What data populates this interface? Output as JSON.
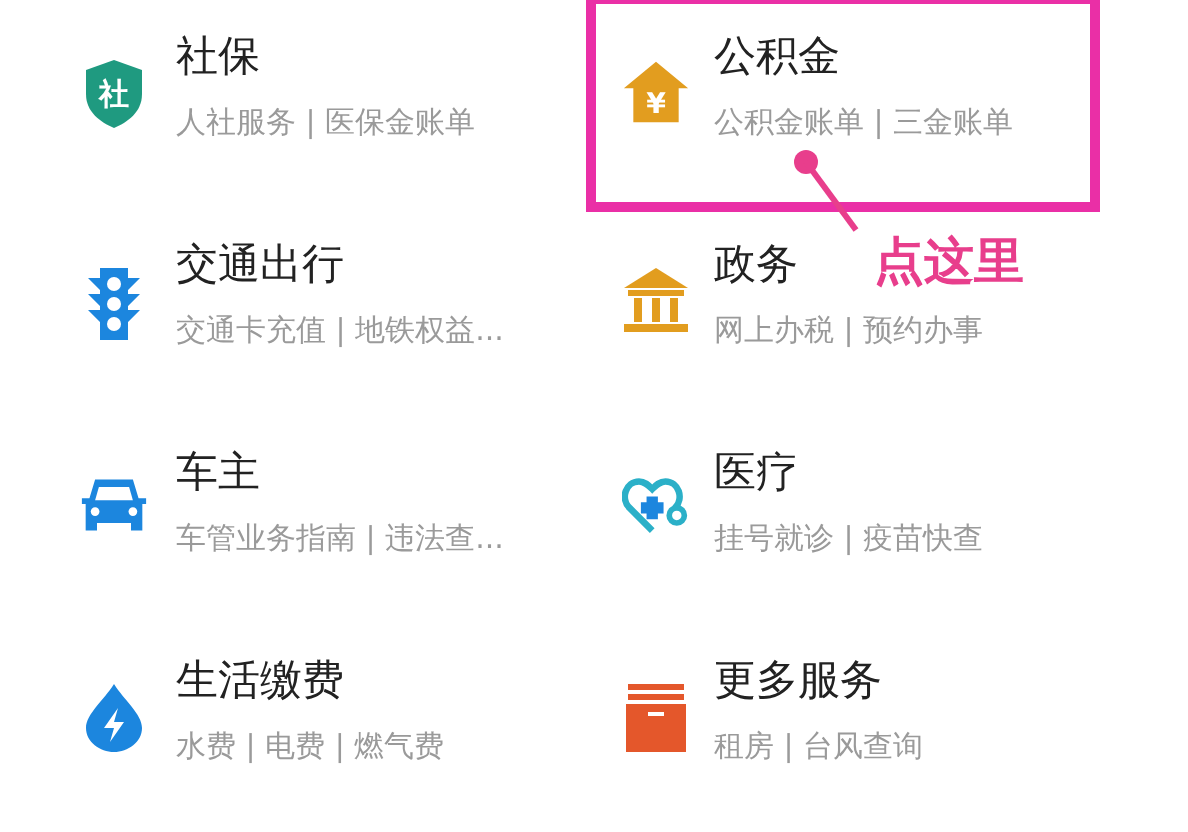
{
  "services": [
    {
      "title": "社保",
      "subtitle": "人社服务 | 医保金账单",
      "icon_text": "社",
      "highlighted": false
    },
    {
      "title": "公积金",
      "subtitle": "公积金账单 | 三金账单",
      "icon_text": "¥",
      "highlighted": true
    },
    {
      "title": "交通出行",
      "subtitle": "交通卡充值 | 地铁权益...",
      "highlighted": false
    },
    {
      "title": "政务",
      "subtitle": "网上办税 | 预约办事",
      "highlighted": false
    },
    {
      "title": "车主",
      "subtitle": "车管业务指南 | 违法查...",
      "highlighted": false
    },
    {
      "title": "医疗",
      "subtitle": "挂号就诊 | 疫苗快查",
      "highlighted": false
    },
    {
      "title": "生活缴费",
      "subtitle": "水费 | 电费 | 燃气费",
      "highlighted": false
    },
    {
      "title": "更多服务",
      "subtitle": "租房 | 台风查询",
      "highlighted": false
    }
  ],
  "callout": {
    "label": "点这里"
  }
}
